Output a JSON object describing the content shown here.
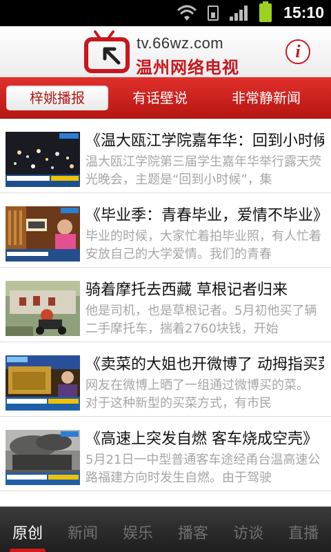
{
  "status_bar": {
    "time": "15:10",
    "icons": [
      "wifi-icon",
      "sim-icon",
      "signal-icon",
      "battery-icon"
    ],
    "battery_color": "#9ad21f"
  },
  "header": {
    "logo_url_text": "tv.66wz.com",
    "logo_cn_text": "温州网络电视",
    "info_label": "i",
    "brand_color": "#c8161d"
  },
  "tabs": [
    {
      "label": "梓姚播报",
      "active": true
    },
    {
      "label": "有话壁说",
      "active": false
    },
    {
      "label": "非常静新闻",
      "active": false
    }
  ],
  "news": [
    {
      "title": "《温大瓯江学院嘉年华：回到小时候》",
      "desc": "温大瓯江学院第三届学生嘉年华举行露天荧光晚会，主题是“回到小时候”，集"
    },
    {
      "title": "《毕业季：青春毕业，爱情不毕业》",
      "desc": "毕业的时候，大家忙着拍毕业照，有人忙着安放自己的大学爱情。我们的青春"
    },
    {
      "title": "骑着摩托去西藏 草根记者归来",
      "desc": "他是司机，也是草根记者。5月初他买了辆二手摩托车，揣着2760块钱，开始"
    },
    {
      "title": "《卖菜的大姐也开微博了 动拇指买菜》",
      "desc": "网友在微博上晒了一组通过微博买的菜。 对于这种新型的买菜方式，有市民"
    },
    {
      "title": "《高速上突发自燃 客车烧成空壳》",
      "desc": "5月21日一中型普通客车途经甬台温高速公路福建方向时发生自燃。由于驾驶"
    }
  ],
  "bottom_nav": [
    {
      "label": "原创",
      "active": true
    },
    {
      "label": "新闻",
      "active": false
    },
    {
      "label": "娱乐",
      "active": false
    },
    {
      "label": "播客",
      "active": false
    },
    {
      "label": "访谈",
      "active": false
    },
    {
      "label": "直播",
      "active": false
    }
  ],
  "accent_color": "#c8161d"
}
